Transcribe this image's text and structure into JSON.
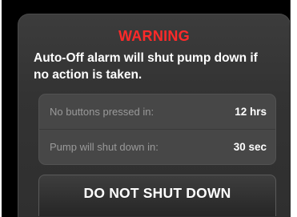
{
  "alert": {
    "title": "WARNING",
    "message": "Auto-Off alarm will shut pump down if no action is taken.",
    "title_color": "#ff2a2a"
  },
  "status": [
    {
      "label": "No buttons pressed in:",
      "value": "12 hrs"
    },
    {
      "label": "Pump will shut down in:",
      "value": "30 sec"
    }
  ],
  "actions": {
    "dismiss_label": "DO NOT SHUT DOWN"
  }
}
